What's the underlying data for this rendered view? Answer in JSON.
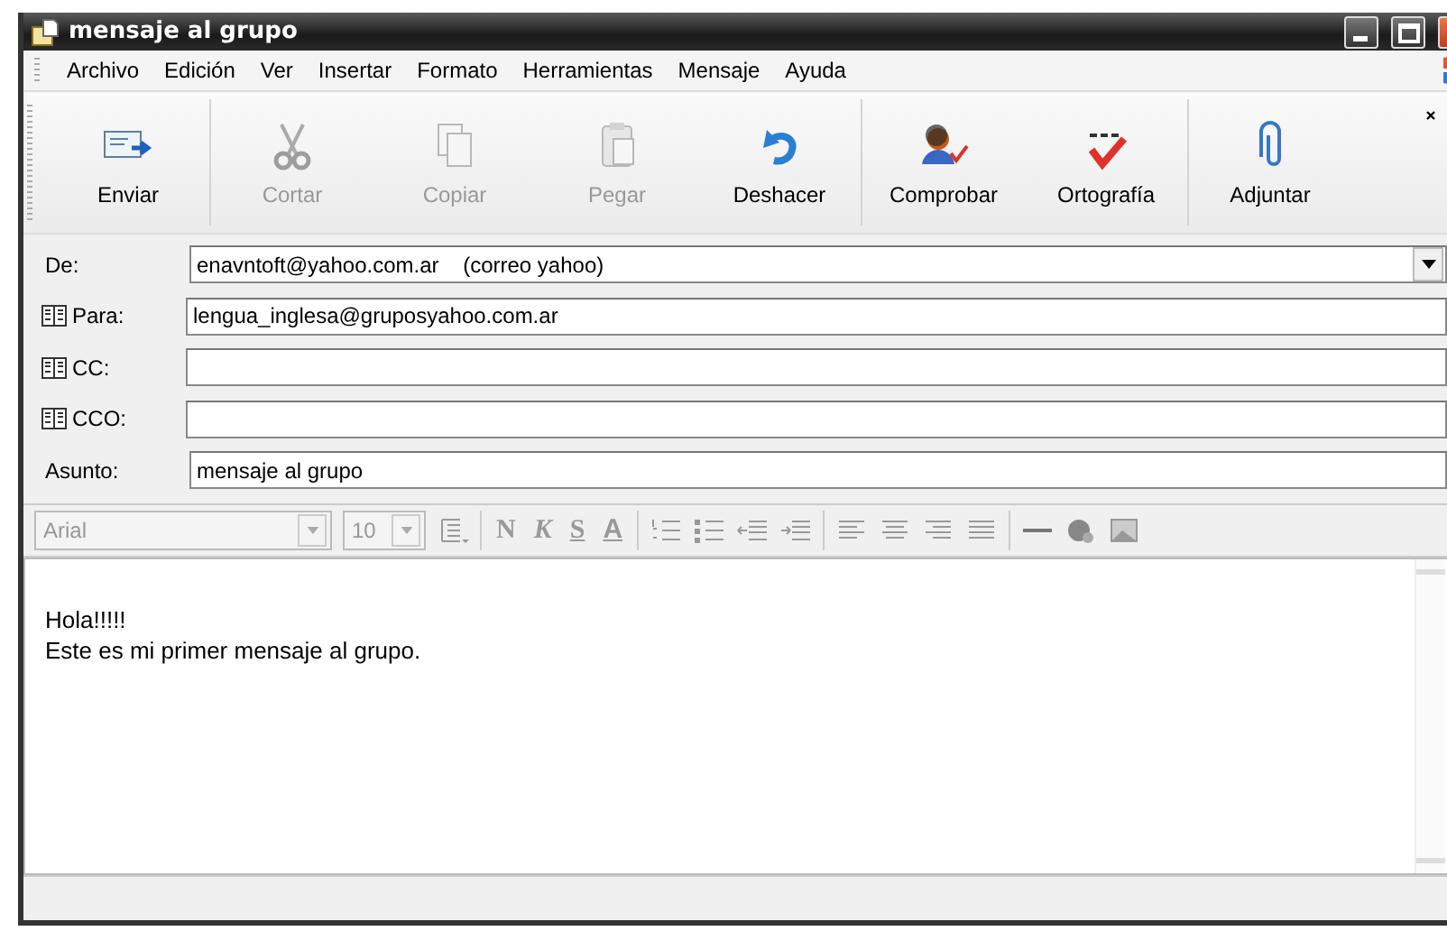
{
  "window": {
    "title": "mensaje al grupo"
  },
  "menu": [
    "Archivo",
    "Edición",
    "Ver",
    "Insertar",
    "Formato",
    "Herramientas",
    "Mensaje",
    "Ayuda"
  ],
  "toolbar": {
    "groups": [
      [
        {
          "kind": "send",
          "label": "Enviar",
          "disabled": false
        }
      ],
      [
        {
          "kind": "cut",
          "label": "Cortar",
          "disabled": true
        },
        {
          "kind": "copy",
          "label": "Copiar",
          "disabled": true
        },
        {
          "kind": "paste",
          "label": "Pegar",
          "disabled": true
        },
        {
          "kind": "undo",
          "label": "Deshacer",
          "disabled": false
        }
      ],
      [
        {
          "kind": "check",
          "label": "Comprobar",
          "disabled": false
        },
        {
          "kind": "spell",
          "label": "Ortografía",
          "disabled": false
        }
      ],
      [
        {
          "kind": "attach",
          "label": "Adjuntar",
          "disabled": false
        }
      ]
    ]
  },
  "fields": [
    {
      "kind": "dropdown",
      "label": "De:",
      "value": "enavntoft@yahoo.com.ar    (correo yahoo)"
    },
    {
      "kind": "address",
      "label": "Para:",
      "value": "lengua_inglesa@gruposyahoo.com.ar"
    },
    {
      "kind": "address",
      "label": "CC:"
    },
    {
      "kind": "address",
      "label": "CCO:"
    },
    {
      "kind": "text",
      "label": "Asunto:",
      "value": "mensaje al grupo"
    }
  ],
  "format_toolbar": {
    "font": "Arial",
    "size": "10",
    "style_buttons": [
      "N",
      "K",
      "S",
      "A"
    ]
  },
  "body": {
    "lines": [
      "Hola!!!!!",
      "Este es mi primer mensaje al grupo."
    ]
  }
}
